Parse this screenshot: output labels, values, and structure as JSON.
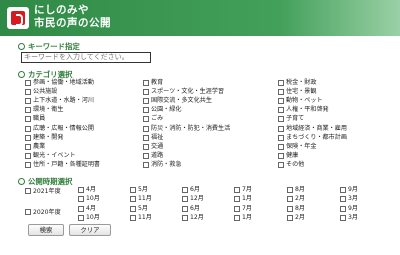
{
  "header": {
    "title_line1": "にしのみや",
    "title_line2": "市民の声の公開"
  },
  "keyword": {
    "heading": "キーワード指定",
    "placeholder": "キーワードを入力してください。"
  },
  "category": {
    "heading": "カテゴリ選択",
    "columns": [
      [
        "参画・協働・地域活動",
        "公共施設",
        "上下水道・水路・河川",
        "環境・衛生",
        "職員",
        "広聴・広報・情報公開",
        "建築・開発",
        "農業",
        "観光・イベント",
        "住所・戸籍・各種証明書"
      ],
      [
        "教育",
        "スポーツ・文化・生涯学習",
        "国際交流・多文化共生",
        "公園・緑化",
        "ごみ",
        "防災・消防・防犯・消費生活",
        "福祉",
        "交通",
        "道路",
        "消防・救急"
      ],
      [
        "税金・財政",
        "住宅・景観",
        "動物・ペット",
        "人権・平和啓発",
        "子育て",
        "地域経済・商業・雇用",
        "まちづくり・都市計画",
        "保険・年金",
        "健康",
        "その他"
      ]
    ]
  },
  "period": {
    "heading": "公開時期選択",
    "years": [
      {
        "label": "2021年度",
        "months": [
          "4月",
          "5月",
          "6月",
          "7月",
          "8月",
          "9月",
          "10月",
          "11月",
          "12月",
          "1月",
          "2月",
          "3月"
        ]
      },
      {
        "label": "2020年度",
        "months": [
          "4月",
          "5月",
          "6月",
          "7月",
          "8月",
          "9月",
          "10月",
          "11月",
          "12月",
          "1月",
          "2月",
          "3月"
        ]
      }
    ]
  },
  "buttons": {
    "search": "検索",
    "clear": "クリア"
  }
}
